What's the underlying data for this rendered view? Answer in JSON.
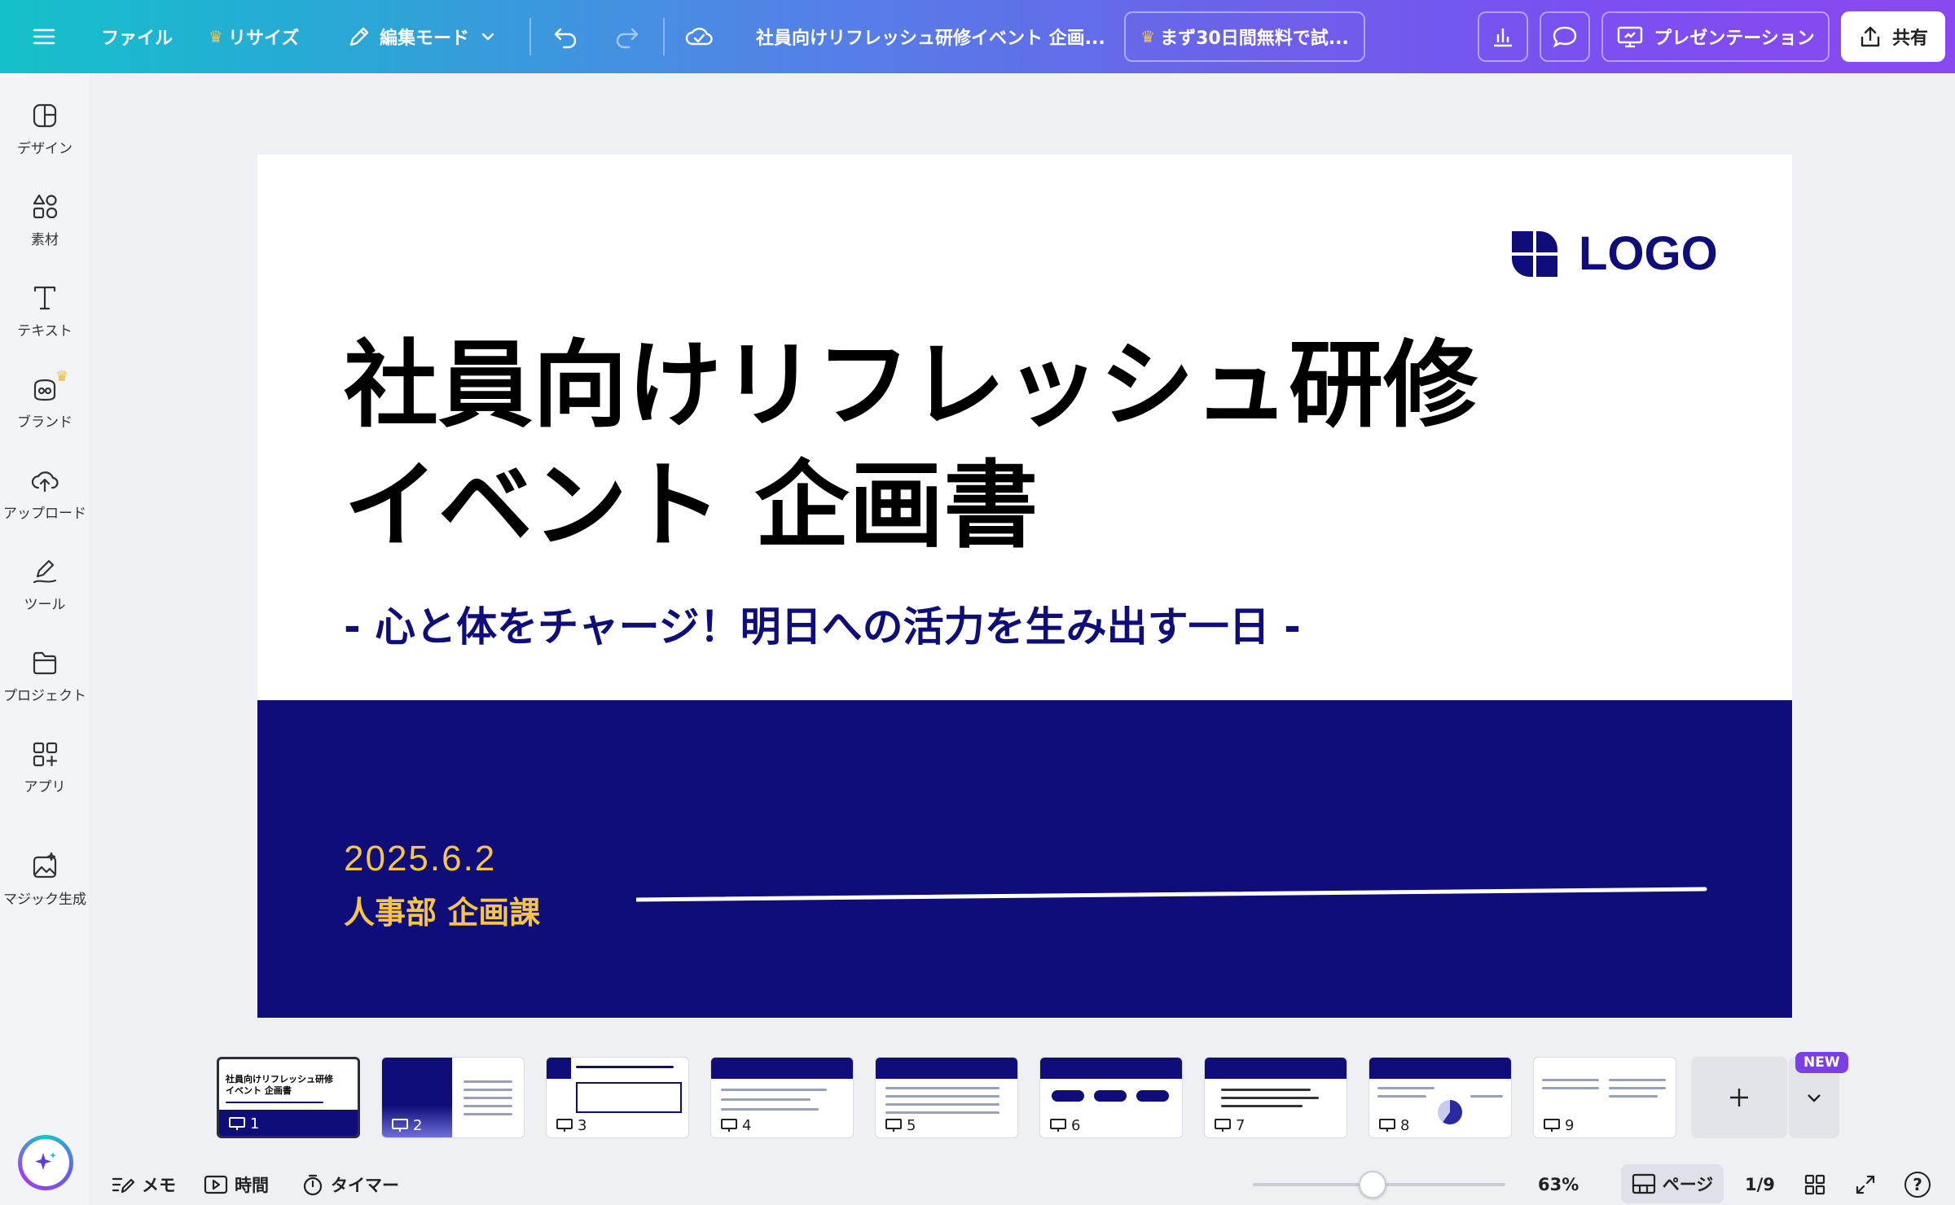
{
  "topbar": {
    "file_label": "ファイル",
    "resize_label": "リサイズ",
    "edit_mode_label": "編集モード",
    "doc_title": "社員向けリフレッシュ研修イベント 企画...",
    "trial_label": "まず30日間無料で試...",
    "present_label": "プレゼンテーション",
    "share_label": "共有"
  },
  "sidebar": {
    "items": [
      {
        "label": "デザイン",
        "icon": "design-icon"
      },
      {
        "label": "素材",
        "icon": "elements-icon"
      },
      {
        "label": "テキスト",
        "icon": "text-icon"
      },
      {
        "label": "ブランド",
        "icon": "brand-icon"
      },
      {
        "label": "アップロード",
        "icon": "upload-icon"
      },
      {
        "label": "ツール",
        "icon": "tools-icon"
      },
      {
        "label": "プロジェクト",
        "icon": "folder-icon"
      },
      {
        "label": "アプリ",
        "icon": "apps-icon"
      },
      {
        "label": "マジック生成",
        "icon": "magic-media-icon"
      }
    ]
  },
  "slide": {
    "logo_text": "LOGO",
    "title_line1": "社員向けリフレッシュ研修",
    "title_line2": "イベント 企画書",
    "subtitle": "- 心と体をチャージ！明日への活力を生み出す一日 -",
    "date": "2025.6.2",
    "department": "人事部 企画課",
    "colors": {
      "navy": "#0e0d7a",
      "gold": "#f5c54a"
    }
  },
  "thumbnails": {
    "pages": [
      "1",
      "2",
      "3",
      "4",
      "5",
      "6",
      "7",
      "8",
      "9"
    ],
    "selected": 1,
    "new_badge": "NEW"
  },
  "bottombar": {
    "notes_label": "メモ",
    "time_label": "時間",
    "timer_label": "タイマー",
    "zoom": "63%",
    "zoom_level": 0.63,
    "page_label": "ページ",
    "page_counter": "1/9",
    "help_label": "?"
  }
}
